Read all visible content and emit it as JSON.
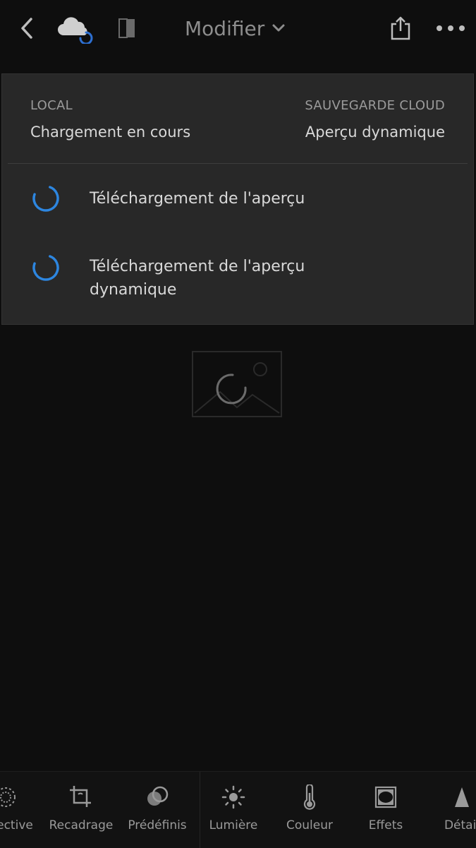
{
  "header": {
    "title": "Modifier",
    "icons": [
      "back-chevron-icon",
      "cloud-sync-icon",
      "compare-icon",
      "chevron-down-icon",
      "share-icon",
      "more-icon"
    ]
  },
  "sync_panel": {
    "local_label": "LOCAL",
    "local_value": "Chargement en cours",
    "cloud_label": "SAUVEGARDE CLOUD",
    "cloud_value": "Aperçu dynamique",
    "tasks": [
      {
        "label": "Téléchargement de l'aperçu"
      },
      {
        "label": "Téléchargement de l'aperçu dynamique"
      }
    ]
  },
  "toolbar": {
    "tools": [
      {
        "label": "Sélective",
        "icon": "selective-icon"
      },
      {
        "label": "Recadrage",
        "icon": "crop-icon"
      },
      {
        "label": "Prédéfinis",
        "icon": "presets-icon"
      },
      {
        "label": "Lumière",
        "icon": "light-icon"
      },
      {
        "label": "Couleur",
        "icon": "color-icon"
      },
      {
        "label": "Effets",
        "icon": "effects-icon"
      },
      {
        "label": "Détail",
        "icon": "detail-icon"
      }
    ]
  },
  "colors": {
    "background": "#0e0e0e",
    "panel": "#282828",
    "accent_blue": "#2d86e0"
  }
}
